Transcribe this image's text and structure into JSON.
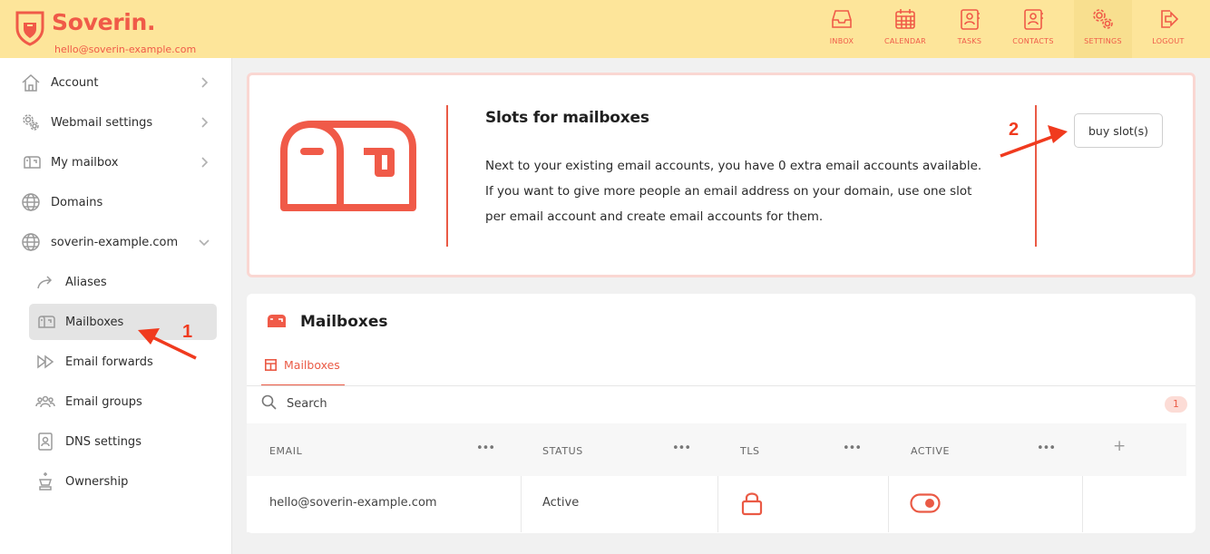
{
  "brand": {
    "name": "Soverin.",
    "email": "hello@soverin-example.com"
  },
  "colors": {
    "accent": "#f05a48",
    "header_bg": "#fde59a",
    "annotation": "#f03a1e"
  },
  "topnav": [
    {
      "label": "INBOX",
      "icon": "inbox-icon"
    },
    {
      "label": "CALENDAR",
      "icon": "calendar-icon"
    },
    {
      "label": "TASKS",
      "icon": "tasks-icon"
    },
    {
      "label": "CONTACTS",
      "icon": "contacts-icon"
    },
    {
      "label": "SETTINGS",
      "icon": "settings-icon",
      "active": true
    },
    {
      "label": "LOGOUT",
      "icon": "logout-icon"
    }
  ],
  "sidebar": {
    "items": [
      {
        "label": "Account",
        "icon": "home-icon"
      },
      {
        "label": "Webmail settings",
        "icon": "gears-icon"
      },
      {
        "label": "My mailbox",
        "icon": "mailbox-icon"
      },
      {
        "label": "Domains",
        "icon": "globe-icon"
      },
      {
        "label": "soverin-example.com",
        "icon": "globe-icon"
      },
      {
        "label": "Aliases",
        "icon": "alias-arrow-icon"
      },
      {
        "label": "Mailboxes",
        "icon": "mailbox-icon",
        "selected": true
      },
      {
        "label": "Email forwards",
        "icon": "forward-icon"
      },
      {
        "label": "Email groups",
        "icon": "group-icon"
      },
      {
        "label": "DNS settings",
        "icon": "dns-icon"
      },
      {
        "label": "Ownership",
        "icon": "ownership-icon"
      }
    ]
  },
  "slots": {
    "title": "Slots for mailboxes",
    "description": "Next to your existing email accounts, you have 0 extra email accounts available. If you want to give more people an email address on your domain, use one slot per email account and create email accounts for them.",
    "button": "buy slot(s)"
  },
  "mailboxes": {
    "title": "Mailboxes",
    "tab": "Mailboxes",
    "search_placeholder": "Search",
    "count": "1",
    "columns": [
      "EMAIL",
      "STATUS",
      "TLS",
      "ACTIVE"
    ],
    "rows": [
      {
        "email": "hello@soverin-example.com",
        "status": "Active",
        "tls": "locked",
        "active": true
      }
    ]
  },
  "annotations": {
    "step1": "1",
    "step2": "2"
  }
}
